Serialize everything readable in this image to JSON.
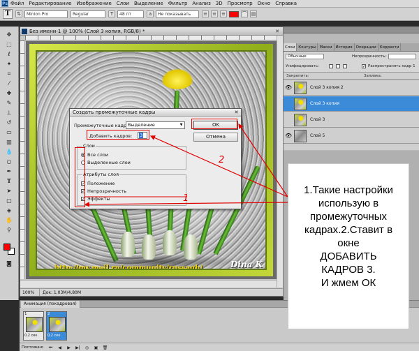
{
  "menubar": {
    "items": [
      "Файл",
      "Редактирование",
      "Изображение",
      "Слои",
      "Выделение",
      "Фильтр",
      "Анализ",
      "3D",
      "Просмотр",
      "Окно",
      "Справка"
    ]
  },
  "options_bar": {
    "tool_glyph": "T",
    "font_family": "Minion Pro",
    "font_style": "Regular",
    "font_size": "48 пт",
    "antialias": "Не показывать"
  },
  "document": {
    "title": "Без имени-1 @ 100% (Слой 3 копия, RGB/8) *",
    "zoom": "100%",
    "doc_info": "Док: 1,03M/4,80M",
    "watermark_url": "http://my.mail.ru/community/russagh/",
    "watermark_signature": "Dina K"
  },
  "layers_panel": {
    "tabs": [
      "Слои",
      "Контуры",
      "Маски",
      "История",
      "Операции",
      "Корректи"
    ],
    "blend_mode": "Обычные",
    "opacity_label": "Непрозрачность:",
    "unify_label": "Унифицировать:",
    "propagate_label": "Распространять кадр 1",
    "lock_label": "Закрепить:",
    "fill_label": "Заливка:",
    "layers": [
      {
        "name": "Слой 3 копия 2",
        "visible": true,
        "selected": false
      },
      {
        "name": "Слой 3 копия",
        "visible": false,
        "selected": true
      },
      {
        "name": "Слой 3",
        "visible": false,
        "selected": false
      },
      {
        "name": "Слой 5",
        "visible": true,
        "selected": false
      }
    ]
  },
  "animation_panel": {
    "tab_label": "Анимация (покадровая)",
    "loop_option": "Постоянно",
    "frames": [
      {
        "number": "1",
        "delay": "0,2 сек.",
        "selected": false
      },
      {
        "number": "2",
        "delay": "0,2 сек.",
        "selected": true
      }
    ]
  },
  "dialog": {
    "title": "Создать промежуточные кадры",
    "tween_label": "Промежуточные кадры:",
    "tween_value": "Выделение",
    "add_frames_label": "Добавить кадров:",
    "add_frames_value": "3",
    "ok_label": "OK",
    "cancel_label": "Отмена",
    "layers_group": {
      "legend": "Слои",
      "options": [
        {
          "label": "Все слои",
          "checked": true
        },
        {
          "label": "Выделенные слои",
          "checked": false
        }
      ]
    },
    "params_group": {
      "legend": "Атрибуты слоя",
      "options": [
        {
          "label": "Положение",
          "checked": true
        },
        {
          "label": "Непрозрачность",
          "checked": true
        },
        {
          "label": "Эффекты",
          "checked": true
        }
      ]
    }
  },
  "annotations": {
    "marker_1": "1",
    "marker_2": "2",
    "callout_lines": [
      "1.Такие настройки",
      "использую в",
      "промежуточных",
      "кадрах.2.Ставит в",
      "окне",
      "ДОБАВИТЬ",
      "КАДРОВ 3.",
      "И жмем ОК"
    ],
    "annotation_color": "#e00000"
  },
  "colors": {
    "selection_blue": "#3b8bd8",
    "foreground": "#ff0000",
    "background": "#ffffff"
  }
}
